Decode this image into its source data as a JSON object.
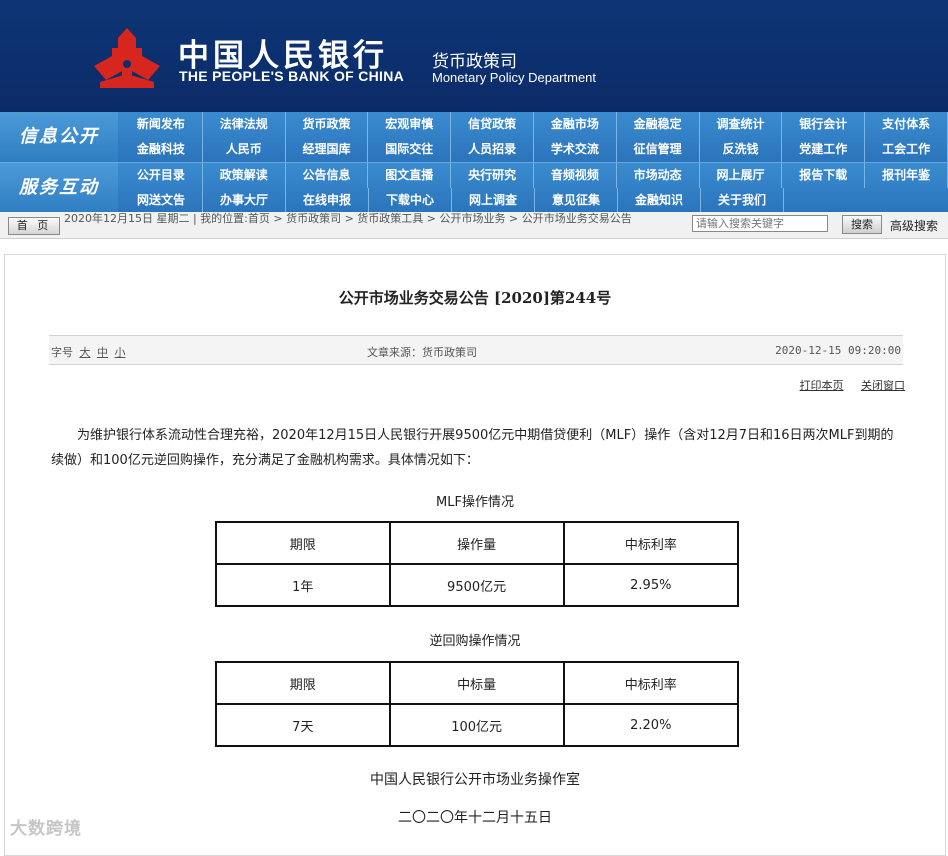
{
  "header": {
    "bank_name_cn": "中国人民银行",
    "bank_name_en": "THE PEOPLE'S BANK OF CHINA",
    "dept_cn": "货币政策司",
    "dept_en": "Monetary Policy Department",
    "colors": {
      "header_bg": "#0b2f6e",
      "logo_red": "#d7261e",
      "nav_blue": "#2e7fc4"
    }
  },
  "nav": {
    "groups": [
      {
        "title": "信息公开",
        "rows": [
          [
            "新闻发布",
            "法律法规",
            "货币政策",
            "宏观审慎",
            "信贷政策",
            "金融市场",
            "金融稳定",
            "调查统计",
            "银行会计",
            "支付体系"
          ],
          [
            "金融科技",
            "人民币",
            "经理国库",
            "国际交往",
            "人员招录",
            "学术交流",
            "征信管理",
            "反洗钱",
            "党建工作",
            "工会工作"
          ]
        ]
      },
      {
        "title": "服务互动",
        "rows": [
          [
            "公开目录",
            "政策解读",
            "公告信息",
            "图文直播",
            "央行研究",
            "音频视频",
            "市场动态",
            "网上展厅",
            "报告下载",
            "报刊年鉴"
          ],
          [
            "网送文告",
            "办事大厅",
            "在线申报",
            "下载中心",
            "网上调查",
            "意见征集",
            "金融知识",
            "关于我们"
          ]
        ]
      }
    ]
  },
  "breadcrumb": {
    "home_label": "首 页",
    "text": "2020年12月15日 星期二 | 我的位置:首页 > 货币政策司 > 货币政策工具 > 公开市场业务 > 公开市场业务交易公告",
    "search_placeholder": "请输入搜索关键字",
    "search_button": "搜索",
    "advanced_search": "高级搜索"
  },
  "article": {
    "title": "公开市场业务交易公告 [2020]第244号",
    "font_size_label": "字号",
    "font_sizes": [
      "大",
      "中",
      "小"
    ],
    "source": "文章来源：货币政策司",
    "date": "2020-12-15 09:20:00",
    "print_label": "打印本页",
    "close_label": "关闭窗口",
    "paragraph": "为维护银行体系流动性合理充裕，2020年12月15日人民银行开展9500亿元中期借贷便利（MLF）操作（含对12月7日和16日两次MLF到期的续做）和100亿元逆回购操作，充分满足了金融机构需求。具体情况如下：",
    "tables": [
      {
        "caption": "MLF操作情况",
        "headers": [
          "期限",
          "操作量",
          "中标利率"
        ],
        "row": [
          "1年",
          "9500亿元",
          "2.95%"
        ]
      },
      {
        "caption": "逆回购操作情况",
        "headers": [
          "期限",
          "中标量",
          "中标利率"
        ],
        "row": [
          "7天",
          "100亿元",
          "2.20%"
        ]
      }
    ],
    "signoff_org": "中国人民银行公开市场业务操作室",
    "signoff_date": "二〇二〇年十二月十五日"
  },
  "watermark": "大数跨境"
}
